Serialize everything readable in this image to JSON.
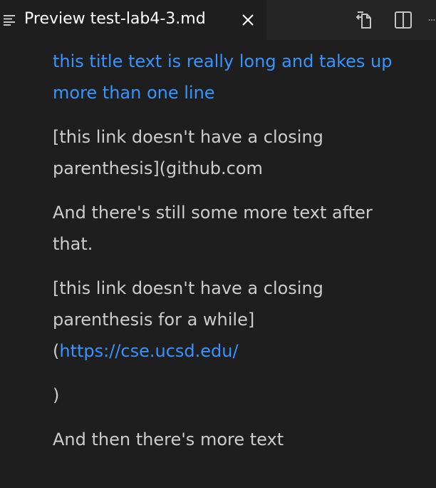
{
  "tab": {
    "title": "Preview test-lab4-3.md",
    "icon": "preview-lines-icon",
    "close_icon": "close-icon"
  },
  "actions": [
    {
      "name": "open-source-icon"
    },
    {
      "name": "split-editor-icon"
    },
    {
      "name": "more-actions-icon"
    }
  ],
  "content": {
    "title_text": "this title text is really long and takes up more than one line",
    "p1": "[this link doesn't have a closing parenthesis](github.com",
    "p2": "And there's still some more text after that.",
    "p3_prefix": "[this link doesn't have a closing parenthesis for a while]",
    "p3_paren": "(",
    "p3_link": "https://cse.ucsd.edu/",
    "p4": ")",
    "p5": "And then there's more text"
  },
  "colors": {
    "background": "#1e1e1e",
    "tabbar": "#252526",
    "text": "#cccccc",
    "link": "#3794ff"
  }
}
